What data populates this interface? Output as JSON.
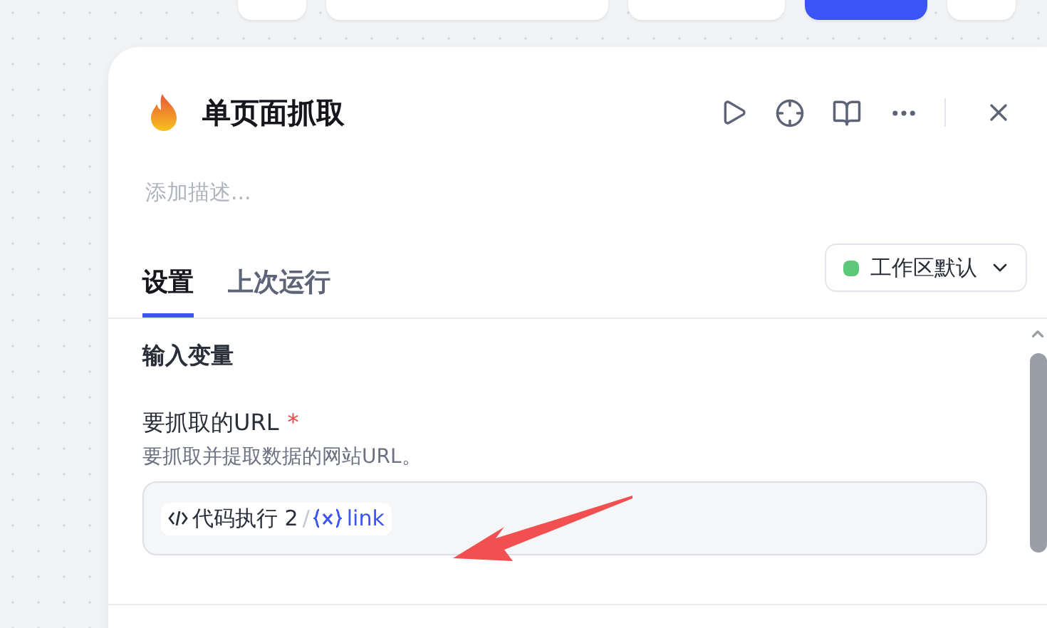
{
  "top_toolbar": {
    "buttons": [
      {
        "kind": "plain"
      },
      {
        "kind": "plain"
      },
      {
        "kind": "plain"
      },
      {
        "kind": "primary"
      },
      {
        "kind": "plain"
      }
    ]
  },
  "panel": {
    "title": "单页面抓取",
    "description_placeholder": "添加描述...",
    "tabs": [
      {
        "label": "设置",
        "selected": true
      },
      {
        "label": "上次运行",
        "selected": false
      }
    ],
    "environment": {
      "label": "工作区默认",
      "color": "#5cc97a"
    },
    "section": {
      "title": "输入变量",
      "fields": [
        {
          "label": "要抓取的URL",
          "required_mark": "*",
          "help": "要抓取并提取数据的网站URL。",
          "value": {
            "node": "代码执行 2",
            "separator": "/",
            "variable": "link"
          }
        }
      ]
    }
  }
}
